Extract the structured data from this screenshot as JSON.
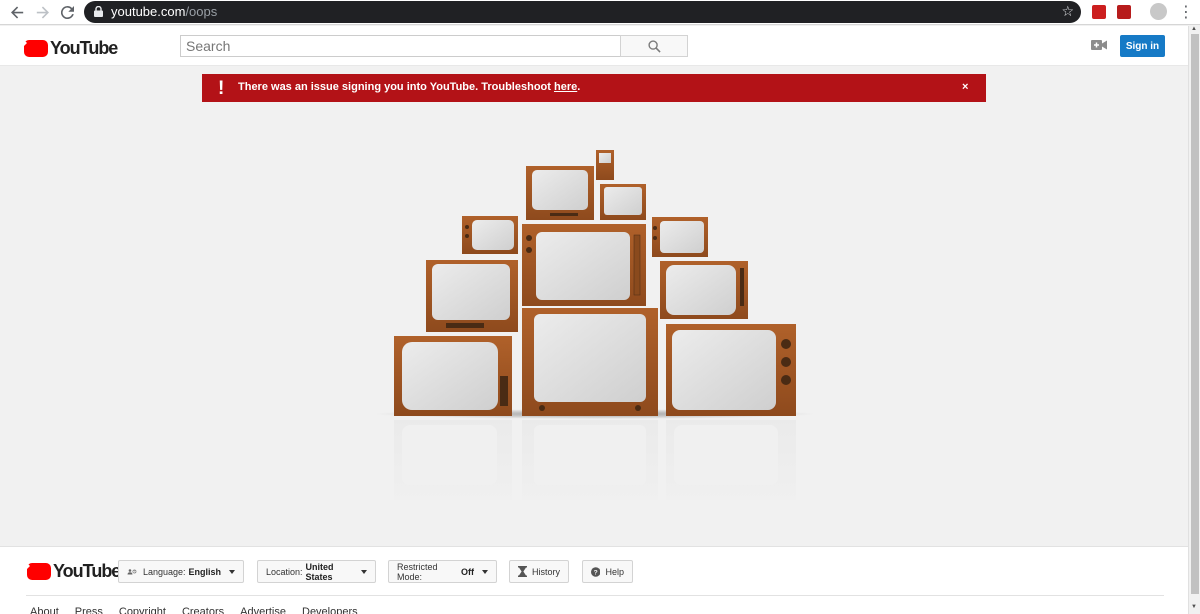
{
  "browser": {
    "url_host": "youtube.com",
    "url_path": "/oops",
    "back_icon": "back-arrow-icon",
    "forward_icon": "forward-arrow-icon",
    "reload_icon": "reload-icon"
  },
  "header": {
    "logo_text": "YouTube",
    "search_placeholder": "Search",
    "search_value": "",
    "signin_label": "Sign in",
    "accent": "#ff0000",
    "signin_color": "#167ac6"
  },
  "alert": {
    "icon": "!",
    "message": "There was an issue signing you into YouTube. Troubleshoot ",
    "link_text": "here",
    "message_end": ".",
    "close_label": "×",
    "color": "#b31217"
  },
  "footer": {
    "logo_text": "YouTube",
    "language_prefix": "Language:",
    "language_value": "English",
    "location_prefix": "Location:",
    "location_value": "United States",
    "restricted_prefix": "Restricted Mode:",
    "restricted_value": "Off",
    "history_label": "History",
    "help_label": "Help",
    "links": [
      "About",
      "Press",
      "Copyright",
      "Creators",
      "Advertise",
      "Developers"
    ]
  }
}
